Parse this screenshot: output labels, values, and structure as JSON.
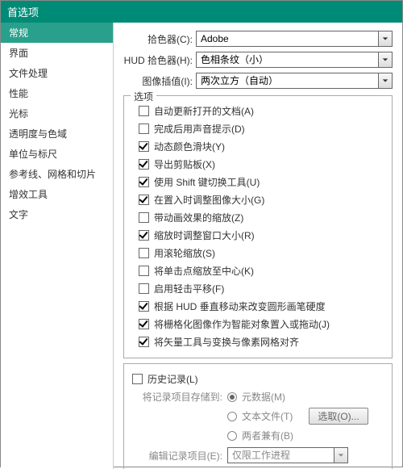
{
  "title": "首选项",
  "sidebar": {
    "items": [
      {
        "label": "常规",
        "selected": true
      },
      {
        "label": "界面",
        "selected": false
      },
      {
        "label": "文件处理",
        "selected": false
      },
      {
        "label": "性能",
        "selected": false
      },
      {
        "label": "光标",
        "selected": false
      },
      {
        "label": "透明度与色域",
        "selected": false
      },
      {
        "label": "单位与标尺",
        "selected": false
      },
      {
        "label": "参考线、网格和切片",
        "selected": false
      },
      {
        "label": "增效工具",
        "selected": false
      },
      {
        "label": "文字",
        "selected": false
      }
    ]
  },
  "pickers": {
    "colorPicker": {
      "label": "拾色器(C):",
      "value": "Adobe"
    },
    "hudPicker": {
      "label": "HUD 拾色器(H):",
      "value": "色相条纹（小）"
    },
    "imageInterp": {
      "label": "图像插值(I):",
      "value": "两次立方（自动）"
    }
  },
  "optionsTitle": "选项",
  "options": [
    {
      "checked": false,
      "label": "自动更新打开的文档(A)"
    },
    {
      "checked": false,
      "label": "完成后用声音提示(D)"
    },
    {
      "checked": true,
      "label": "动态颜色滑块(Y)"
    },
    {
      "checked": true,
      "label": "导出剪贴板(X)"
    },
    {
      "checked": true,
      "label": "使用 Shift 键切换工具(U)"
    },
    {
      "checked": true,
      "label": "在置入时调整图像大小(G)"
    },
    {
      "checked": false,
      "label": "带动画效果的缩放(Z)"
    },
    {
      "checked": true,
      "label": "缩放时调整窗口大小(R)"
    },
    {
      "checked": false,
      "label": "用滚轮缩放(S)"
    },
    {
      "checked": false,
      "label": "将单击点缩放至中心(K)"
    },
    {
      "checked": false,
      "label": "启用轻击平移(F)"
    },
    {
      "checked": true,
      "label": "根据 HUD 垂直移动来改变圆形画笔硬度"
    },
    {
      "checked": true,
      "label": "将栅格化图像作为智能对象置入或拖动(J)"
    },
    {
      "checked": true,
      "label": "将矢量工具与变换与像素网格对齐"
    }
  ],
  "historyLog": {
    "checked": false,
    "label": "历史记录(L)"
  },
  "saveTo": {
    "label": "将记录项目存储到:"
  },
  "radios": [
    {
      "on": true,
      "label": "元数据(M)"
    },
    {
      "on": false,
      "label": "文本文件(T)"
    },
    {
      "on": false,
      "label": "两者兼有(B)"
    }
  ],
  "chooseBtn": "选取(O)...",
  "editItems": {
    "label": "编辑记录项目(E):",
    "value": "仅限工作进程"
  }
}
